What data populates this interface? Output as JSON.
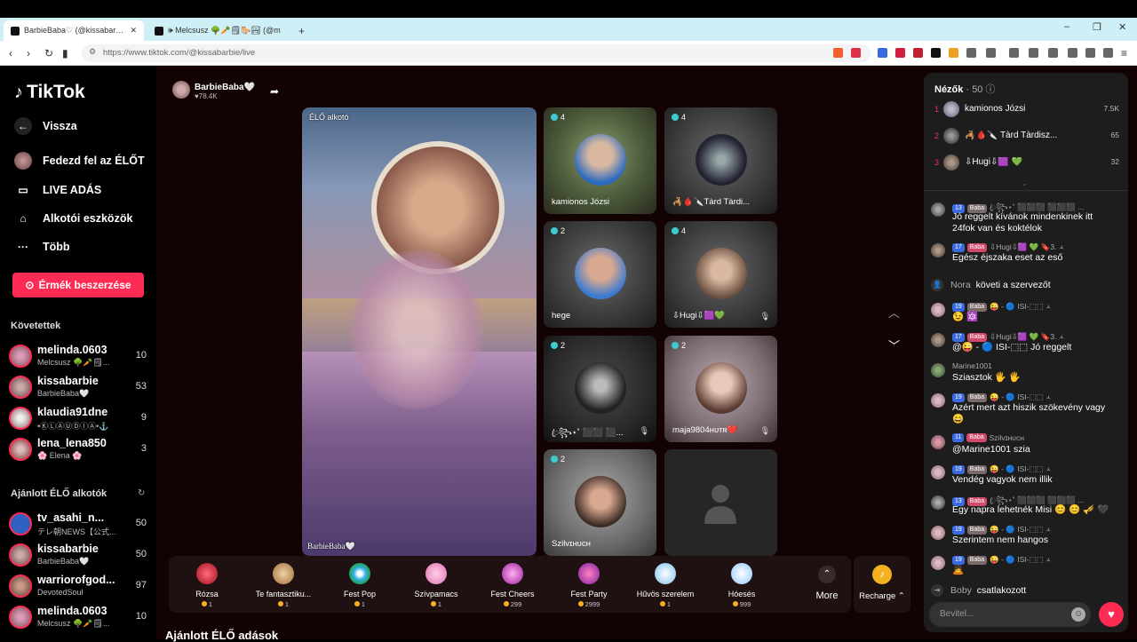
{
  "browser": {
    "tabs": [
      {
        "title": "BarbieBaba♡ (@kissabarbie",
        "active": true
      },
      {
        "title": "🕪 Melcsusz 🌳🥕🗒🐎🏞 (@m",
        "active": false
      }
    ],
    "new_tab": "+",
    "url": "https://www.tiktok.com/@kissabarbie/live"
  },
  "sidebar": {
    "logo": "TikTok",
    "nav": [
      {
        "icon": "arrow-left-icon",
        "label": "Vissza"
      },
      {
        "icon": "avatar",
        "label": "Fedezd fel az ÉLŐT"
      },
      {
        "icon": "video-camera-icon",
        "label": "LIVE ADÁS"
      },
      {
        "icon": "tools-icon",
        "label": "Alkotói eszközök"
      },
      {
        "icon": "more-dots-icon",
        "label": "Több"
      }
    ],
    "coins_button": "Érmék beszerzése",
    "following_heading": "Követettek",
    "following": [
      {
        "name": "melinda.0603",
        "sub": "Melcsusz 🌳🥕🗒...",
        "count": "10"
      },
      {
        "name": "kissabarbie",
        "sub": "BarbieBaba🤍",
        "count": "53"
      },
      {
        "name": "klaudia91dne",
        "sub": "•ⓀⓁⒶⓊⒹⒾⒶ•⚓",
        "count": "9"
      },
      {
        "name": "lena_lena850",
        "sub": "🌸 Elena 🌸",
        "count": "3"
      }
    ],
    "recommended_heading": "Ajánlott ÉLŐ alkotók",
    "recommended": [
      {
        "name": "tv_asahi_n...",
        "sub": "テレ朝NEWS【公式...",
        "count": "50"
      },
      {
        "name": "kissabarbie",
        "sub": "BarbieBaba🤍",
        "count": "50"
      },
      {
        "name": "warriorofgod...",
        "sub": "DevotedSoul",
        "count": "97"
      },
      {
        "name": "melinda.0603",
        "sub": "Melcsusz 🌳🥕🗒...",
        "count": "10"
      }
    ]
  },
  "host": {
    "name": "BarbieBaba🤍",
    "likes": "♥78.4K"
  },
  "main_video": {
    "label": "ÉLŐ alkotó",
    "footer": "BarbieBaba🤍"
  },
  "guests": [
    {
      "count": "4",
      "name": "kamionos Józsi",
      "muted": false
    },
    {
      "count": "4",
      "name": "🦂🩸🔪Tàrd Tàrdi...",
      "muted": false
    },
    {
      "count": "2",
      "name": "hege",
      "muted": false
    },
    {
      "count": "4",
      "name": "⇩Hugi⇩🟪💚",
      "muted": true
    },
    {
      "count": "2",
      "name": "ꦿ꧂⋆˚ ⬛⬛ ⬛...",
      "muted": true
    },
    {
      "count": "2",
      "name": "maja9804ʜᴜᴛʀ❤️",
      "muted": true
    },
    {
      "count": "2",
      "name": "Szilvɪʜᴜᴄʜ",
      "muted": false
    }
  ],
  "gifts": [
    {
      "name": "Rózsa",
      "price": "1",
      "color": "#e0304a"
    },
    {
      "name": "Te fantasztiku...",
      "price": "1",
      "color": "#c8a070"
    },
    {
      "name": "Fest Pop",
      "price": "1",
      "color": "#3ab0e0"
    },
    {
      "name": "Szívpamacs",
      "price": "1",
      "color": "#f090c8"
    },
    {
      "name": "Fest Cheers",
      "price": "299",
      "color": "#d050c0"
    },
    {
      "name": "Fest Party",
      "price": "2999",
      "color": "#c040a0"
    },
    {
      "name": "Hűvös szerelem",
      "price": "1",
      "color": "#a0d0f0"
    },
    {
      "name": "Hóesés",
      "price": "999",
      "color": "#c0e0ff"
    }
  ],
  "more_label": "More",
  "recharge_label": "Recharge ⌃",
  "suggested_heading": "Ajánlott ÉLŐ adások",
  "viewers": {
    "title": "Nézők",
    "count": "· 50",
    "top": [
      {
        "rank": "1",
        "name": "kamionos Józsi",
        "score": "7.5K"
      },
      {
        "rank": "2",
        "name": "🦂🩸🔪 Tàrd Tàrdisz...",
        "score": "65"
      },
      {
        "rank": "3",
        "name": "⇩Hugi⇩🟪 💚",
        "score": "32"
      }
    ]
  },
  "chat": [
    {
      "lvl": "13",
      "tag": "Baba",
      "user": "ꦿ꧂⋆˚ ⬛⬛⬛ ⬛⬛⬛ ...",
      "text": "Jó reggelt kívánok mindenkinek itt 24fok van és koktélok"
    },
    {
      "lvl": "17",
      "tag": "Baba",
      "user": "⇩Hugi⇩🟪 💚  🔖3.  🟀",
      "text": "Egész éjszaka eset az eső"
    },
    {
      "lvl": "19",
      "tag": "Baba",
      "user": "😜 - 🔵 ISI-⬚⬚ 🟀",
      "text": "😉 🔯"
    },
    {
      "lvl": "17",
      "tag": "Baba",
      "user": "⇩Hugi⇩🟪 💚  🔖3.  🟀",
      "text": "@😜 - 🔵 ISI-⬚⬚ Jó reggelt"
    },
    {
      "lvl": "",
      "tag": "",
      "user": "Marine1001",
      "text": "Sziasztok 🖐 🖐"
    },
    {
      "lvl": "19",
      "tag": "Baba",
      "user": "😜 - 🔵 ISI-⬚⬚ 🟀",
      "text": "Azért mert azt hiszik szökevény vagy 😄"
    },
    {
      "lvl": "11",
      "tag": "Baba",
      "user": "Szilvɪʜᴜᴄʜ",
      "text": "@Marine1001 szia"
    },
    {
      "lvl": "19",
      "tag": "Baba",
      "user": "😜 - 🔵 ISI-⬚⬚ 🟀",
      "text": "Vendég vagyok nem illik"
    },
    {
      "lvl": "13",
      "tag": "Baba",
      "user": "ꦿ꧂⋆˚ ⬛⬛⬛ ⬛⬛⬛ ...",
      "text": "Egy napra lehetnék Misi 😊 😊 🎺 🖤"
    },
    {
      "lvl": "19",
      "tag": "Baba",
      "user": "😜 - 🔵 ISI-⬚⬚ 🟀",
      "text": "Szerintem nem hangos"
    },
    {
      "lvl": "19",
      "tag": "Baba",
      "user": "😜 - 🔵 ISI-⬚⬚ 🟀",
      "text": "🙇"
    }
  ],
  "system_msgs": [
    {
      "user": "Nora",
      "text": "követi a szervezőt"
    },
    {
      "user": "Boby",
      "text": "csatlakozott"
    }
  ],
  "input_placeholder": "Bevitel...",
  "accent_color": "#fe2c55"
}
